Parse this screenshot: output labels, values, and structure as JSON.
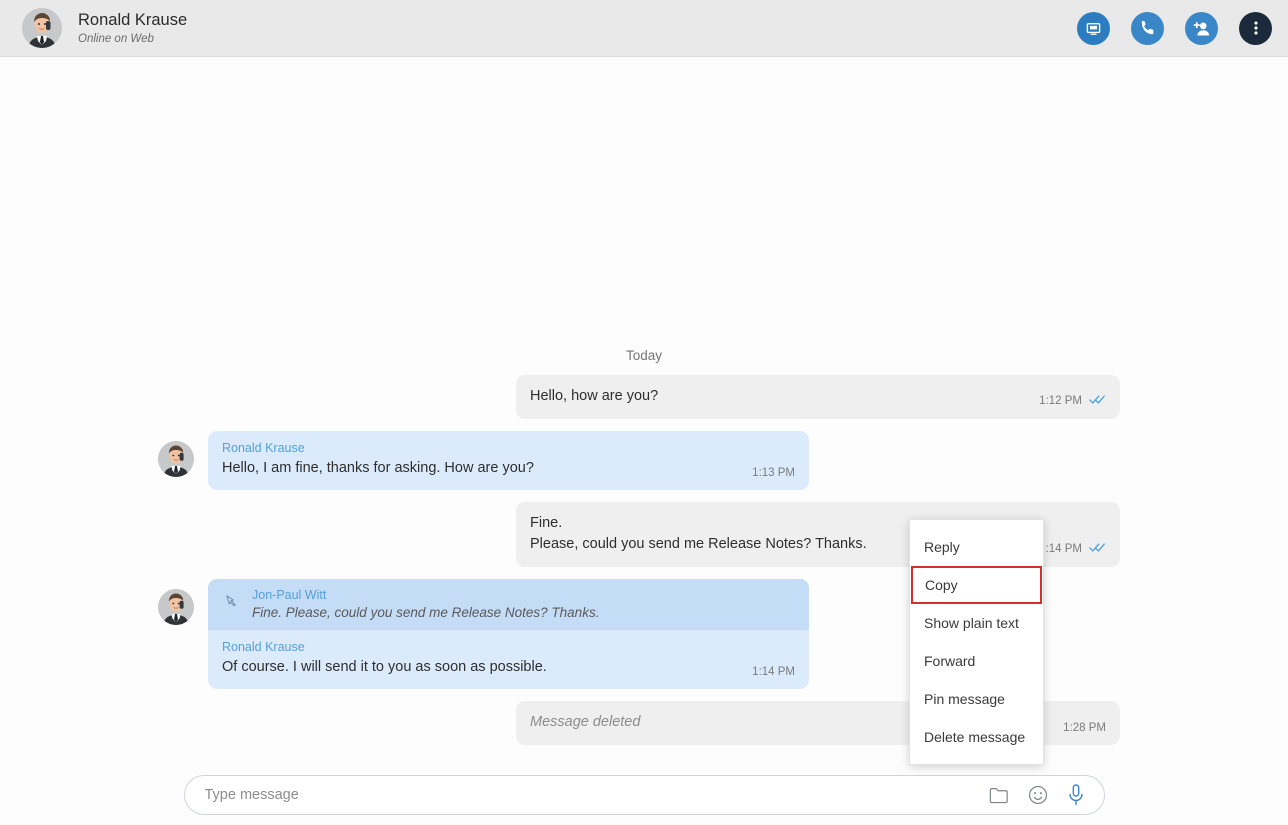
{
  "header": {
    "contact_name": "Ronald Krause",
    "status": "Online on Web",
    "avatar_name": "contact-avatar",
    "actions": [
      {
        "name": "screen-share-icon",
        "label": "Screen share"
      },
      {
        "name": "phone-call-icon",
        "label": "Call"
      },
      {
        "name": "add-person-icon",
        "label": "Add participant"
      },
      {
        "name": "more-options-icon",
        "label": "More options"
      }
    ]
  },
  "chat": {
    "day_divider": "Today",
    "messages": [
      {
        "id": "msg-1",
        "direction": "out",
        "text": "Hello, how are you?",
        "time": "1:12 PM",
        "status": "read"
      },
      {
        "id": "msg-2",
        "direction": "in",
        "author": "Ronald Krause",
        "text": "Hello, I am fine, thanks for asking. How are you?",
        "time": "1:13 PM"
      },
      {
        "id": "msg-3",
        "direction": "out",
        "line1": "Fine.",
        "line2": "Please, could you send me Release Notes? Thanks.",
        "time": ":14 PM",
        "status": "read"
      },
      {
        "id": "msg-4",
        "direction": "in",
        "quote_author": "Jon-Paul Witt",
        "quote_text": "Fine. Please, could you send me Release Notes? Thanks.",
        "author": "Ronald Krause",
        "text": "Of course. I will send it to you as soon as possible.",
        "time": "1:14 PM"
      },
      {
        "id": "msg-5",
        "direction": "out",
        "text": "Message deleted",
        "deleted": true,
        "time": "1:28 PM"
      }
    ]
  },
  "context_menu": {
    "items": [
      {
        "label": "Reply",
        "name": "ctx-reply",
        "highlighted": false
      },
      {
        "label": "Copy",
        "name": "ctx-copy",
        "highlighted": true
      },
      {
        "label": "Show plain text",
        "name": "ctx-show-plain-text",
        "highlighted": false
      },
      {
        "label": "Forward",
        "name": "ctx-forward",
        "highlighted": false
      },
      {
        "label": "Pin message",
        "name": "ctx-pin-message",
        "highlighted": false
      },
      {
        "label": "Delete message",
        "name": "ctx-delete-message",
        "highlighted": false
      }
    ],
    "highlight_color": "#d32f2f"
  },
  "composer": {
    "placeholder": "Type message",
    "value": "",
    "icons": [
      {
        "name": "attachment-folder-icon"
      },
      {
        "name": "emoji-icon"
      },
      {
        "name": "microphone-icon"
      }
    ]
  },
  "colors": {
    "header_bg": "#e9e9e9",
    "outgoing_bubble": "#efefef",
    "incoming_bubble": "#dcebfb",
    "quote_bubble": "#c4dcf6",
    "author_blue": "#55a0d8",
    "accent_blue": "#2b7cc0",
    "check_blue": "#4a9fe0"
  }
}
